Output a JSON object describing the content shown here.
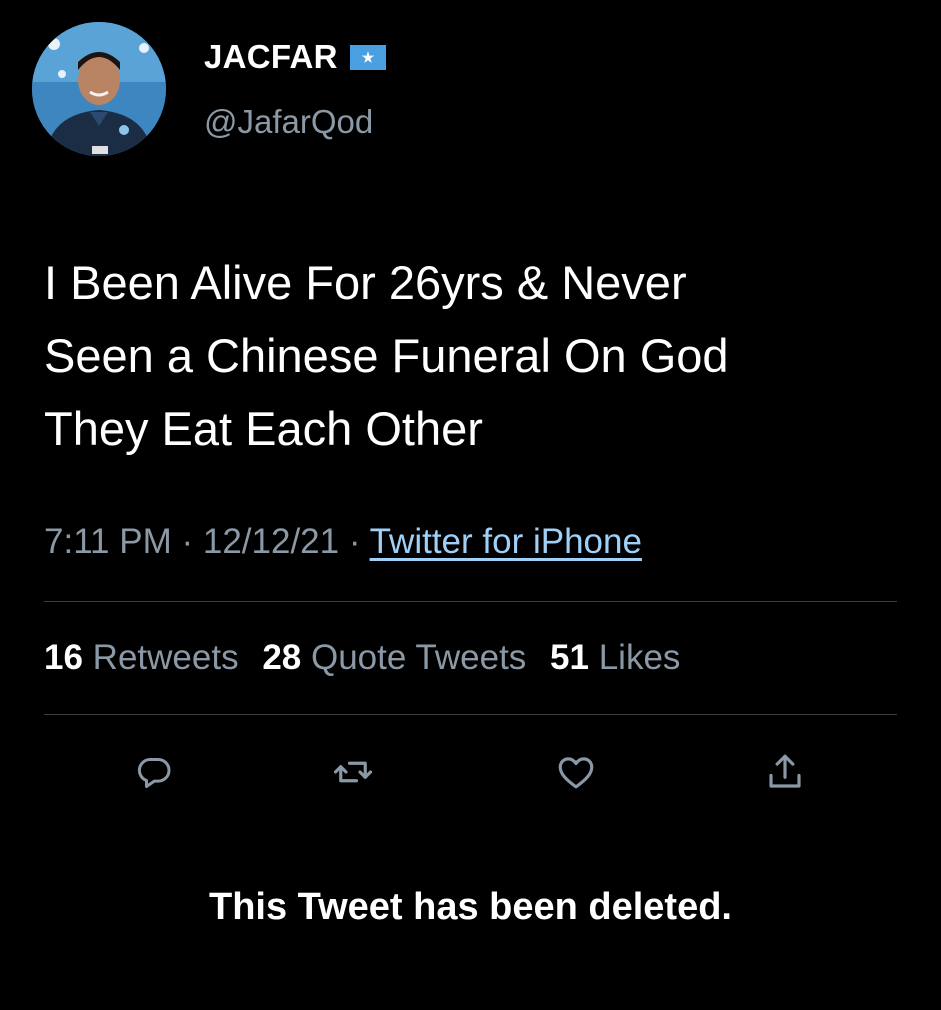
{
  "author": {
    "display_name": "JACFAR",
    "handle": "@JafarQod",
    "flag_icon": "somalia-flag-icon",
    "avatar_icon": "profile-photo"
  },
  "tweet": {
    "lines": [
      "I Been Alive For 26yrs & Never",
      "Seen a Chinese Funeral On God",
      "They Eat Each Other"
    ]
  },
  "meta": {
    "time": "7:11 PM",
    "separator": "·",
    "date": "12/12/21",
    "source": "Twitter for iPhone"
  },
  "stats": {
    "retweets_count": "16",
    "retweets_label": "Retweets",
    "quotes_count": "28",
    "quotes_label": "Quote Tweets",
    "likes_count": "51",
    "likes_label": "Likes"
  },
  "actions": {
    "reply_icon": "reply-icon",
    "retweet_icon": "retweet-icon",
    "like_icon": "heart-icon",
    "share_icon": "share-icon"
  },
  "notice": {
    "text": "This Tweet has been deleted."
  },
  "colors": {
    "background": "#000000",
    "primary_text": "#ffffff",
    "secondary_text": "#8b98a5",
    "link": "#9fd0f8",
    "divider": "#3a3f45"
  }
}
